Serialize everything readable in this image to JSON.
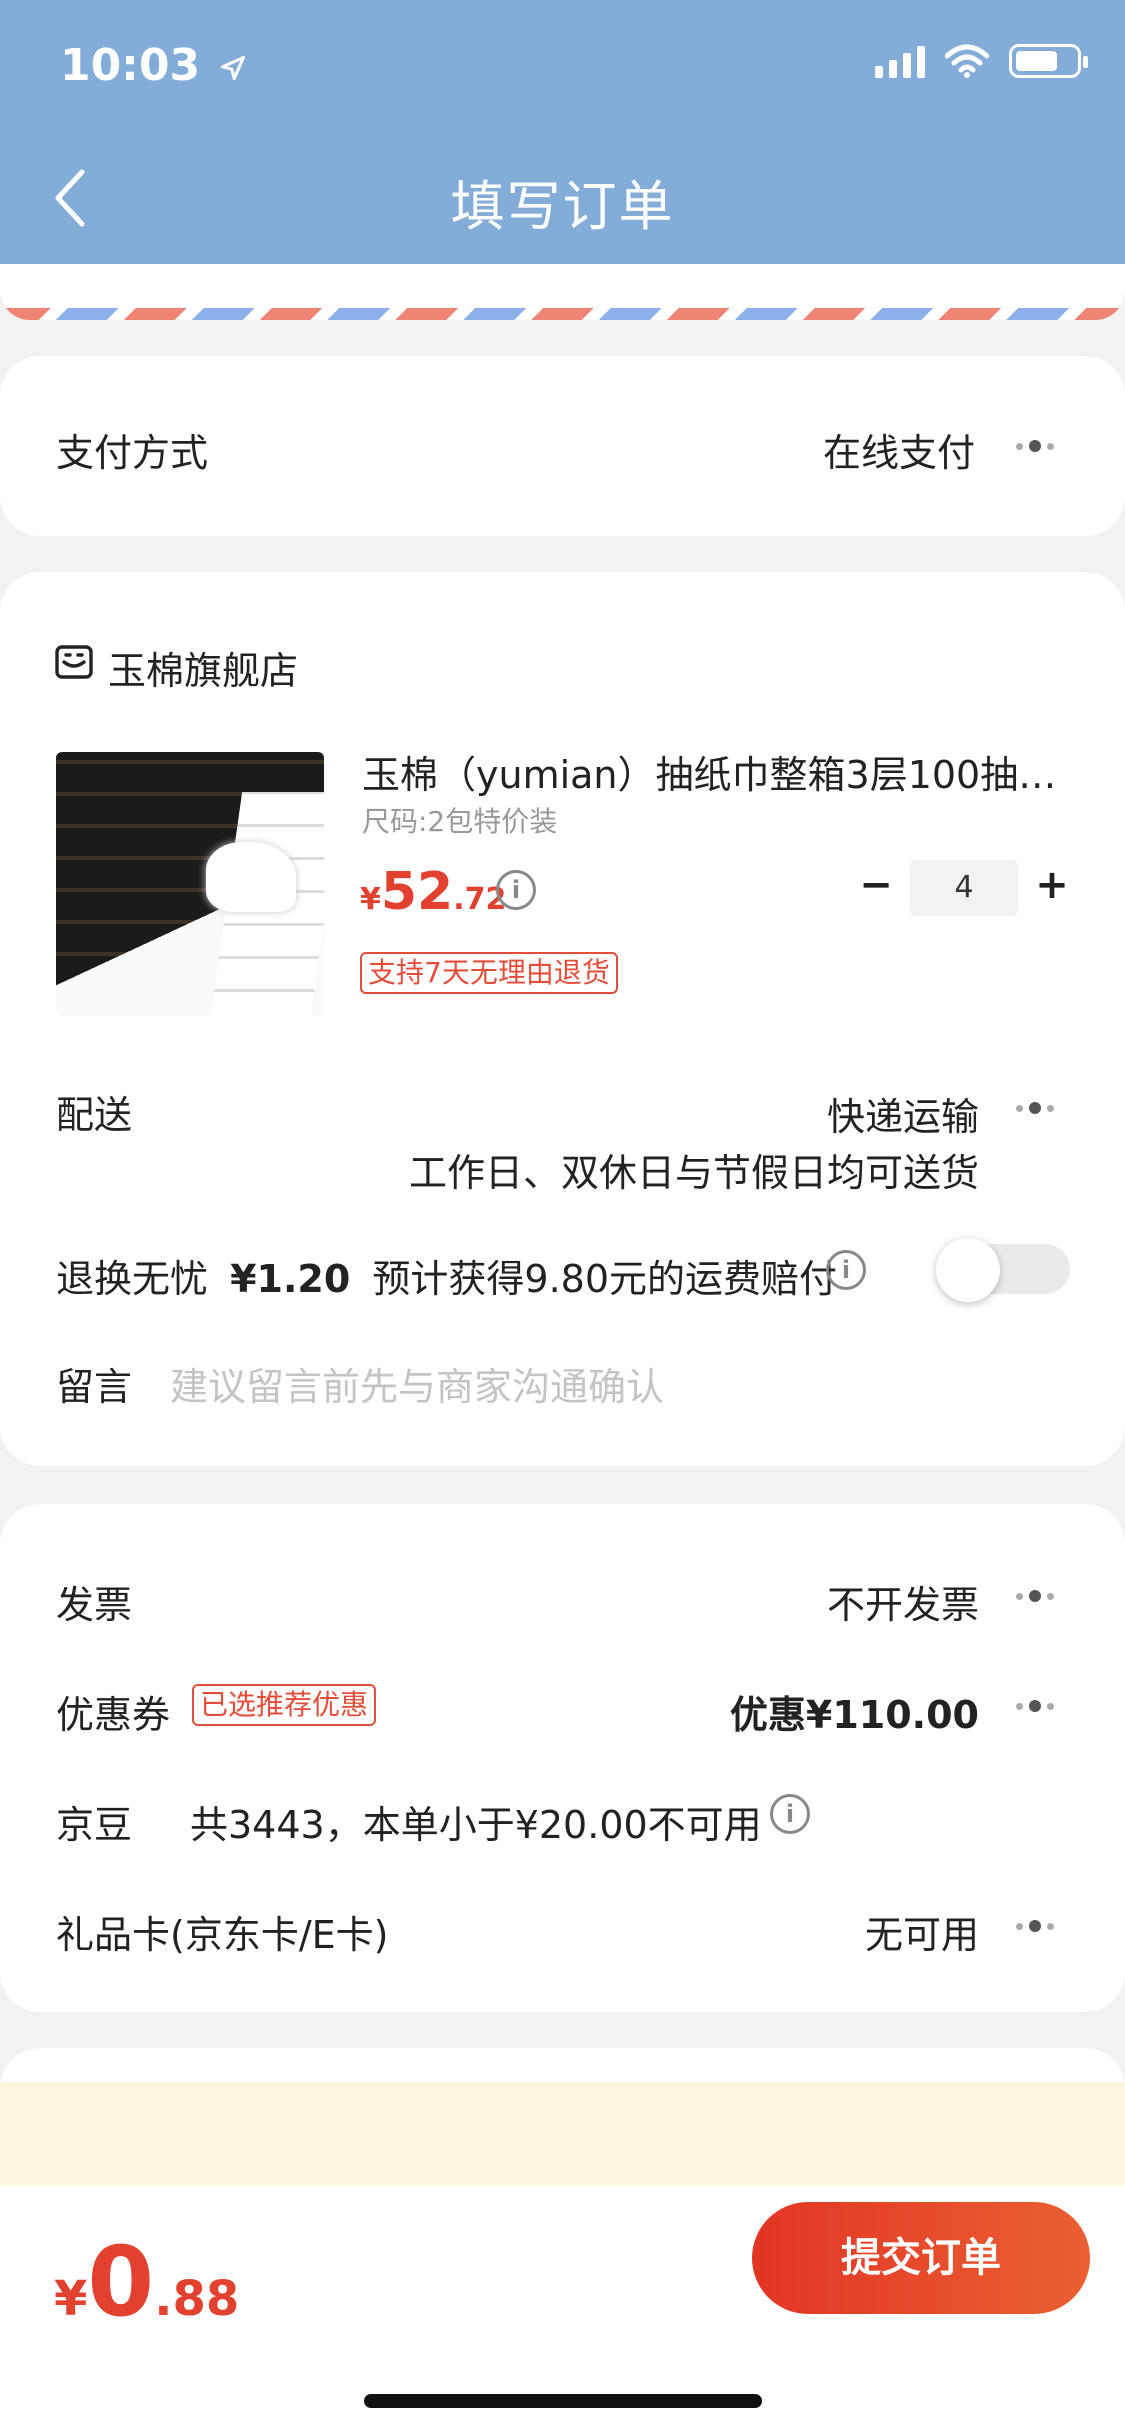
{
  "status_bar": {
    "time": "10:03"
  },
  "header": {
    "title": "填写订单"
  },
  "payment": {
    "label": "支付方式",
    "value": "在线支付"
  },
  "shop": {
    "name": "玉棉旗舰店"
  },
  "product": {
    "title": "玉棉（yumian）抽纸巾整箱3层100抽…",
    "spec": "尺码:2包特价装",
    "price_symbol": "¥",
    "price_int": "52",
    "price_dec": ".72",
    "quantity": "4",
    "return_tag": "支持7天无理由退货"
  },
  "delivery": {
    "label": "配送",
    "method": "快递运输",
    "note": "工作日、双休日与节假日均可送货"
  },
  "return_insurance": {
    "label": "退换无忧",
    "price": "¥1.20",
    "desc": "预计获得9.80元的运费赔付",
    "enabled": false
  },
  "message": {
    "label": "留言",
    "placeholder": "建议留言前先与商家沟通确认"
  },
  "invoice": {
    "label": "发票",
    "value": "不开发票"
  },
  "coupon": {
    "label": "优惠券",
    "tag": "已选推荐优惠",
    "value": "优惠¥110.00"
  },
  "jingdou": {
    "label": "京豆",
    "value": "共3443，本单小于¥20.00不可用"
  },
  "giftcard": {
    "label": "礼品卡(京东卡/E卡)",
    "value": "无可用"
  },
  "bottom": {
    "yen": "¥",
    "total_int": "0",
    "total_dec": ".88",
    "submit_label": "提交订单"
  },
  "colors": {
    "header_bg": "#83acd8",
    "accent_red": "#e2412f",
    "page_bg": "#f2f2f2"
  },
  "icons": [
    "location-arrow-icon",
    "signal-icon",
    "wifi-icon",
    "battery-icon",
    "back-chevron-icon",
    "shop-icon",
    "info-icon",
    "more-dots-icon"
  ]
}
